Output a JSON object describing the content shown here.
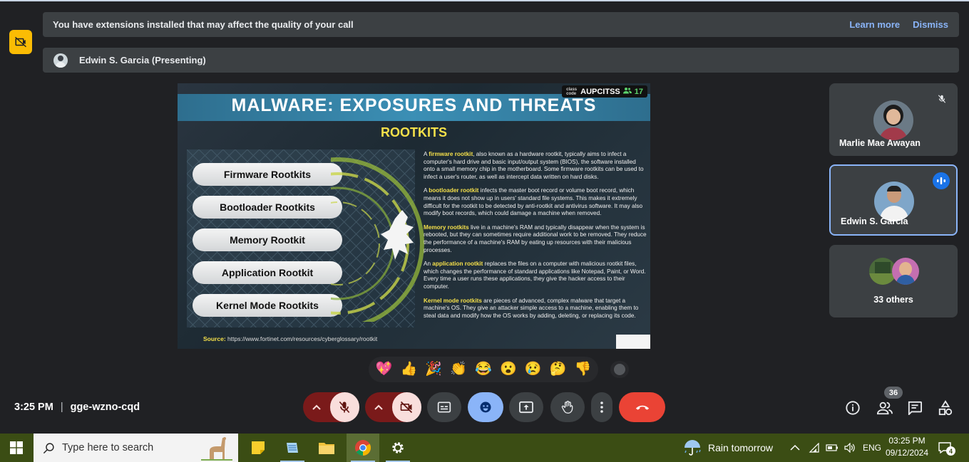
{
  "notification": {
    "message": "You have extensions installed that may affect the quality of your call",
    "learn_more": "Learn more",
    "dismiss": "Dismiss"
  },
  "presenter_bar": {
    "label": "Edwin S. Garcia (Presenting)"
  },
  "slide": {
    "title": "MALWARE: EXPOSURES AND THREATS",
    "subtitle": "ROOTKITS",
    "class_code_label": "class code",
    "class_code": "AUPCITSS",
    "class_count": "17",
    "types": [
      "Firmware Rootkits",
      "Bootloader Rootkits",
      "Memory Rootkit",
      "Application Rootkit",
      "Kernel Mode Rootkits"
    ],
    "paragraphs": [
      {
        "pre": "A ",
        "hl": "firmware rootkit",
        "post": ", also known as a hardware rootkit, typically aims to infect a computer's hard drive and basic input/output system (BIOS), the software installed onto a small memory chip in the motherboard. Some firmware rootkits can be used to infect a user's router, as well as intercept data written on hard disks."
      },
      {
        "pre": "A ",
        "hl": "bootloader rootkit",
        "post": " infects the master boot record or volume boot record, which means it does not show up in users' standard file systems. This makes it extremely difficult for the rootkit to be detected by anti-rootkit and antivirus software. It may also modify boot records, which could damage a machine when removed."
      },
      {
        "pre": "",
        "hl": "Memory rootkits",
        "post": " live in a machine's RAM and typically disappear when the system is rebooted, but they can sometimes require additional work to be removed. They reduce the performance of a machine's RAM by eating up resources with their malicious processes."
      },
      {
        "pre": "An ",
        "hl": "application rootkit",
        "post": " replaces the files on a computer with malicious rootkit files, which changes the performance of standard applications like Notepad, Paint, or Word. Every time a user runs these applications, they give the hacker access to their computer."
      },
      {
        "pre": "",
        "hl": "Kernel mode rootkits",
        "post": " are pieces of advanced, complex malware that target a machine's OS. They give an attacker simple access to a machine, enabling them to steal data and modify how the OS works by adding, deleting, or replacing its code."
      }
    ],
    "source_label": "Source:",
    "source_url": "https://www.fortinet.com/resources/cyberglossary/rootkit"
  },
  "participants": [
    {
      "name": "Marlie Mae Awayan"
    },
    {
      "name": "Edwin S. Garcia"
    },
    {
      "name": "33 others"
    }
  ],
  "reactions": [
    "💖",
    "👍",
    "🎉",
    "👏",
    "😂",
    "😮",
    "😢",
    "🤔",
    "👎"
  ],
  "meeting": {
    "time": "3:25 PM",
    "separator": "|",
    "code": "gge-wzno-cqd",
    "people_count": "36"
  },
  "colors": {
    "background": "#202124",
    "panel": "#3c4043",
    "accent_blue": "#8ab4f8",
    "hangup_red": "#ea4335",
    "alert_yellow": "#fbbc04"
  },
  "taskbar": {
    "search_placeholder": "Type here to search",
    "weather": "Rain tomorrow",
    "language": "ENG",
    "clock_time": "03:25 PM",
    "clock_date": "09/12/2024",
    "notification_count": "4"
  }
}
